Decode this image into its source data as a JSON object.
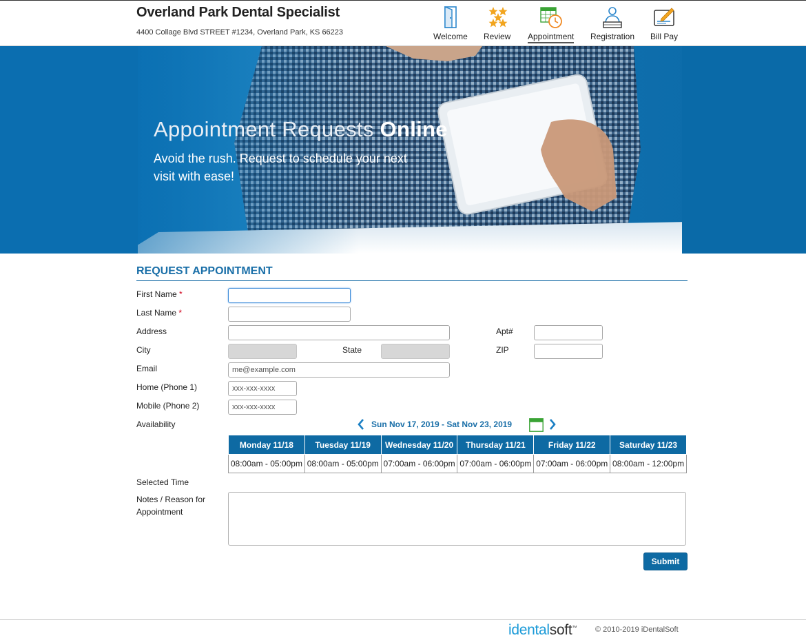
{
  "header": {
    "title": "Overland Park Dental Specialist",
    "address": "4400 Collage Blvd STREET #1234, Overland Park, KS 66223",
    "nav": [
      {
        "label": "Welcome",
        "icon": "door-icon"
      },
      {
        "label": "Review",
        "icon": "stars-icon"
      },
      {
        "label": "Appointment",
        "icon": "calendar-clock-icon",
        "active": true
      },
      {
        "label": "Registration",
        "icon": "person-desk-icon"
      },
      {
        "label": "Bill Pay",
        "icon": "bill-pen-icon"
      }
    ]
  },
  "hero": {
    "title_light": "Appointment Requests ",
    "title_bold": "Online",
    "subtitle": "Avoid the rush. Request to schedule your next visit with ease!"
  },
  "form": {
    "section_title": "REQUEST APPOINTMENT",
    "first_name_label": "First Name",
    "last_name_label": "Last Name",
    "required_mark": "*",
    "address_label": "Address",
    "apt_label": "Apt#",
    "city_label": "City",
    "state_label": "State",
    "zip_label": "ZIP",
    "email_label": "Email",
    "email_placeholder": "me@example.com",
    "home_phone_label": "Home (Phone 1)",
    "mobile_phone_label": "Mobile (Phone 2)",
    "phone_placeholder": "xxx-xxx-xxxx",
    "availability_label": "Availability",
    "week_range": "Sun Nov 17, 2019 - Sat Nov 23, 2019",
    "days": [
      {
        "header": "Monday 11/18",
        "hours": "08:00am - 05:00pm"
      },
      {
        "header": "Tuesday 11/19",
        "hours": "08:00am - 05:00pm"
      },
      {
        "header": "Wednesday 11/20",
        "hours": "07:00am - 06:00pm"
      },
      {
        "header": "Thursday 11/21",
        "hours": "07:00am - 06:00pm"
      },
      {
        "header": "Friday 11/22",
        "hours": "07:00am - 06:00pm"
      },
      {
        "header": "Saturday 11/23",
        "hours": "08:00am - 12:00pm"
      }
    ],
    "selected_time_label": "Selected Time",
    "notes_label_1": "Notes / Reason for",
    "notes_label_2": "Appointment",
    "submit_label": "Submit"
  },
  "footer": {
    "logo_a": "idental",
    "logo_b": "soft",
    "logo_tm": "™",
    "copyright": "© 2010-2019 iDentalSoft"
  },
  "colors": {
    "accent": "#1a6fa8",
    "header_blue": "#0e6aa3",
    "required": "#d0021b"
  }
}
